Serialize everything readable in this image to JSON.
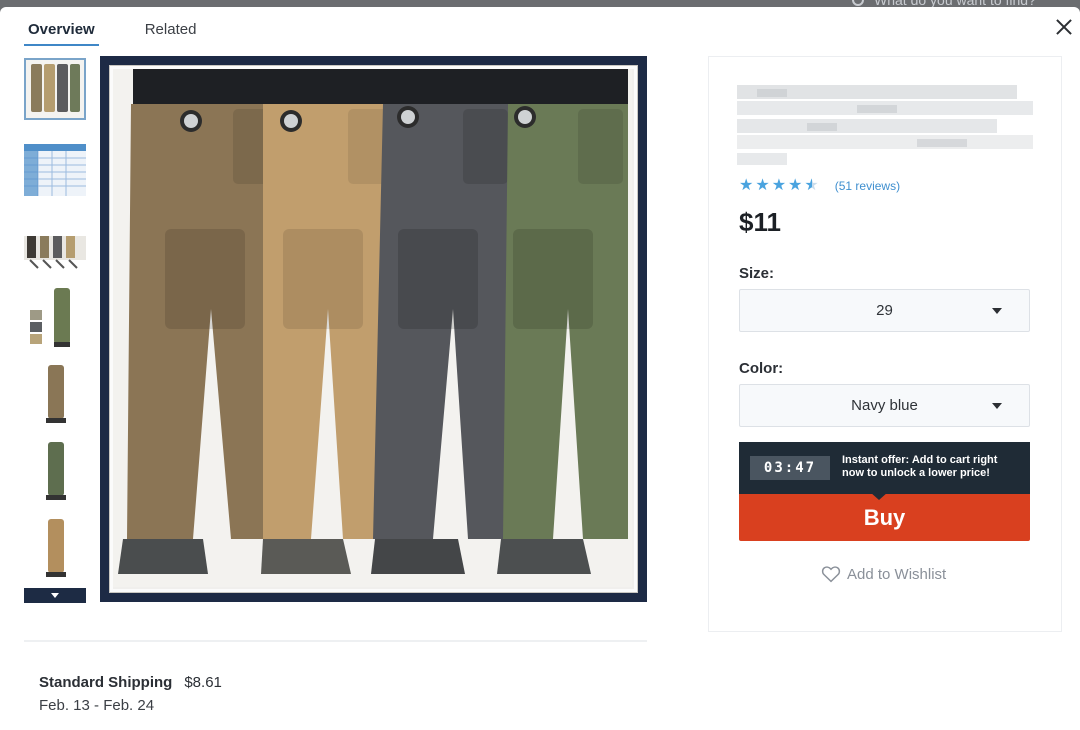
{
  "backdrop": {
    "search_placeholder": "What do you want to find?"
  },
  "tabs": [
    {
      "label": "Overview",
      "active": true
    },
    {
      "label": "Related",
      "active": false
    }
  ],
  "thumbnails": [
    {
      "name": "thumb-lineup",
      "colors": [
        "#8a7b5c",
        "#b59d6f",
        "#5c5c5e",
        "#6e7a5a"
      ]
    },
    {
      "name": "thumb-size-chart",
      "colors": [
        "#4f8fc9"
      ]
    },
    {
      "name": "thumb-lineup-shoes",
      "colors": [
        "#3e3a35",
        "#8a7b5c",
        "#5c5c5e",
        "#b59d6f"
      ]
    },
    {
      "name": "thumb-front-detail",
      "colors": [
        "#6b7a52"
      ]
    },
    {
      "name": "thumb-khaki",
      "colors": [
        "#8a7656"
      ]
    },
    {
      "name": "thumb-green",
      "colors": [
        "#5e6e4f"
      ]
    },
    {
      "name": "thumb-tan",
      "colors": [
        "#b38f5e"
      ]
    }
  ],
  "main_image": {
    "pant_colors": [
      "#8b7555",
      "#c19e6d",
      "#55575c",
      "#6a7a56"
    ]
  },
  "product": {
    "rating": 4.5,
    "reviews_label": "(51 reviews)",
    "price": "$11",
    "size_label": "Size:",
    "size_value": "29",
    "color_label": "Color:",
    "color_value": "Navy blue"
  },
  "offer": {
    "timer": "03:47",
    "text": "Instant offer: Add to cart right now to unlock a lower price!"
  },
  "buy_label": "Buy",
  "wishlist_label": "Add to Wishlist",
  "shipping": {
    "label": "Standard Shipping",
    "price": "$8.61",
    "dates": "Feb. 13 - Feb. 24"
  },
  "colors": {
    "accent": "#3f87c7",
    "buy": "#d9401f",
    "star": "#4aa3df",
    "offer_bg": "#1f2b36"
  }
}
